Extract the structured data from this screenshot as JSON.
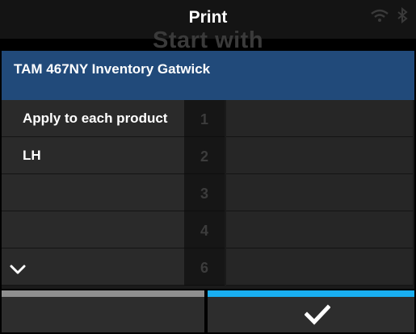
{
  "header": {
    "title": "Print",
    "status_icons": [
      "wifi-icon",
      "bluetooth-icon"
    ]
  },
  "background": {
    "heading": "Start with"
  },
  "dropdown": {
    "selected": "TAM 467NY Inventory Gatwick",
    "items": [
      {
        "label": "Apply to each product"
      },
      {
        "label": "LH"
      },
      {
        "label": ""
      },
      {
        "label": ""
      },
      {
        "label": ""
      }
    ],
    "row_numbers": [
      "1",
      "2",
      "3",
      "4",
      "6"
    ],
    "expand_icon": "chevron-down-icon"
  },
  "footer": {
    "cancel_icon": "none",
    "confirm_icon": "check-icon",
    "colors": {
      "cancel_bar": "#8f8f8f",
      "confirm_bar": "#19aef0"
    }
  },
  "colors": {
    "selected_bg": "#214a7a",
    "background": "#000000"
  }
}
